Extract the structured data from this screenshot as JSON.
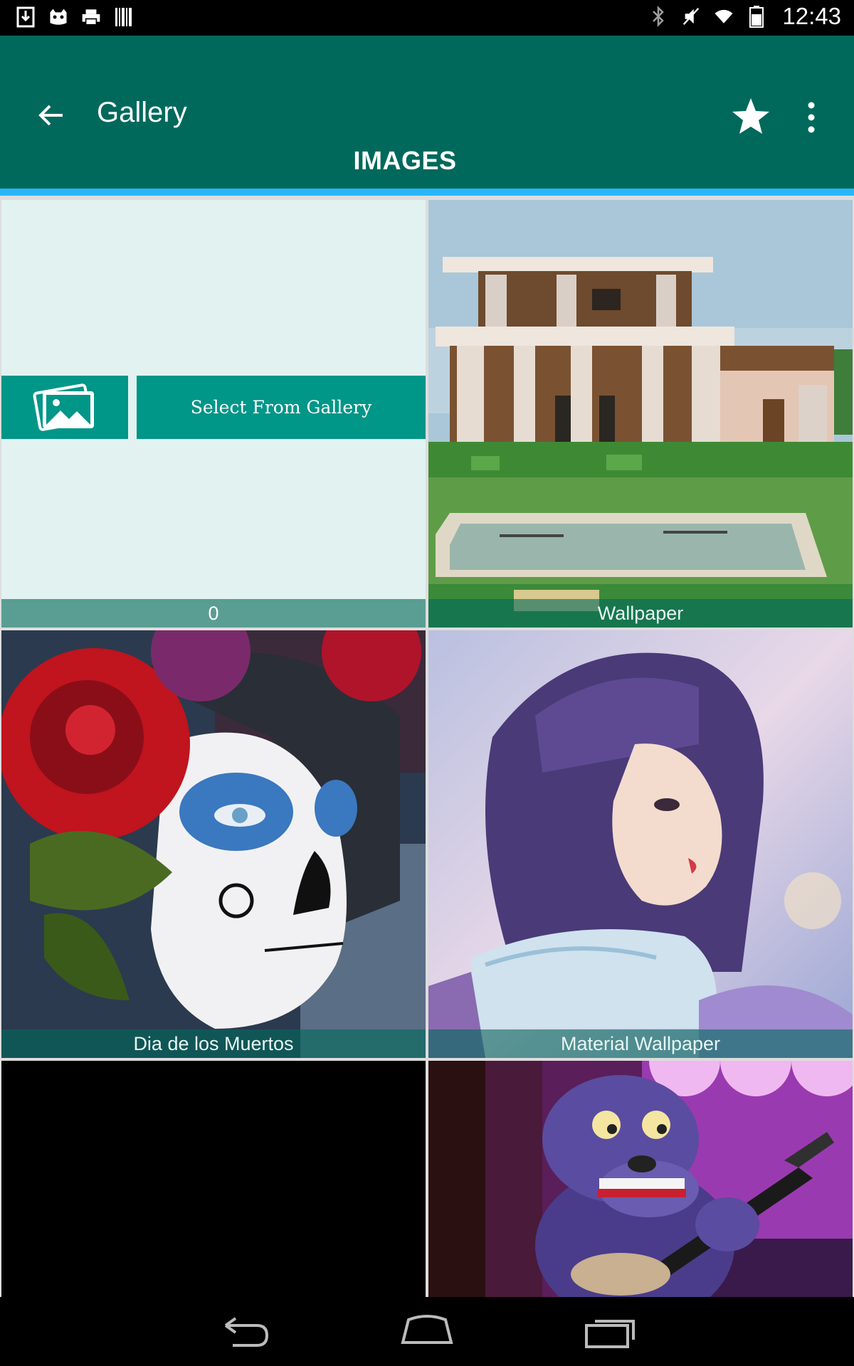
{
  "status_bar": {
    "time": "12:43",
    "left_icons": [
      "download-icon",
      "cat-icon",
      "printer-icon",
      "barcode-icon"
    ],
    "right_icons": [
      "bluetooth-icon",
      "vibrate-icon",
      "wifi-icon",
      "battery-icon"
    ]
  },
  "app_bar": {
    "title": "Gallery",
    "tab_label": "IMAGES",
    "colors": {
      "bar": "#00695c",
      "indicator": "#29b6f6",
      "accent": "#009688"
    }
  },
  "gallery": {
    "select_from_gallery_label": "Select From Gallery",
    "tiles": [
      {
        "caption": "0"
      },
      {
        "caption": "Wallpaper"
      },
      {
        "caption": "Dia de los Muertos"
      },
      {
        "caption": "Material Wallpaper"
      },
      {
        "caption": ""
      },
      {
        "caption": ""
      }
    ]
  },
  "nav_bar": {
    "buttons": [
      "back-icon",
      "home-icon",
      "recents-icon"
    ]
  }
}
